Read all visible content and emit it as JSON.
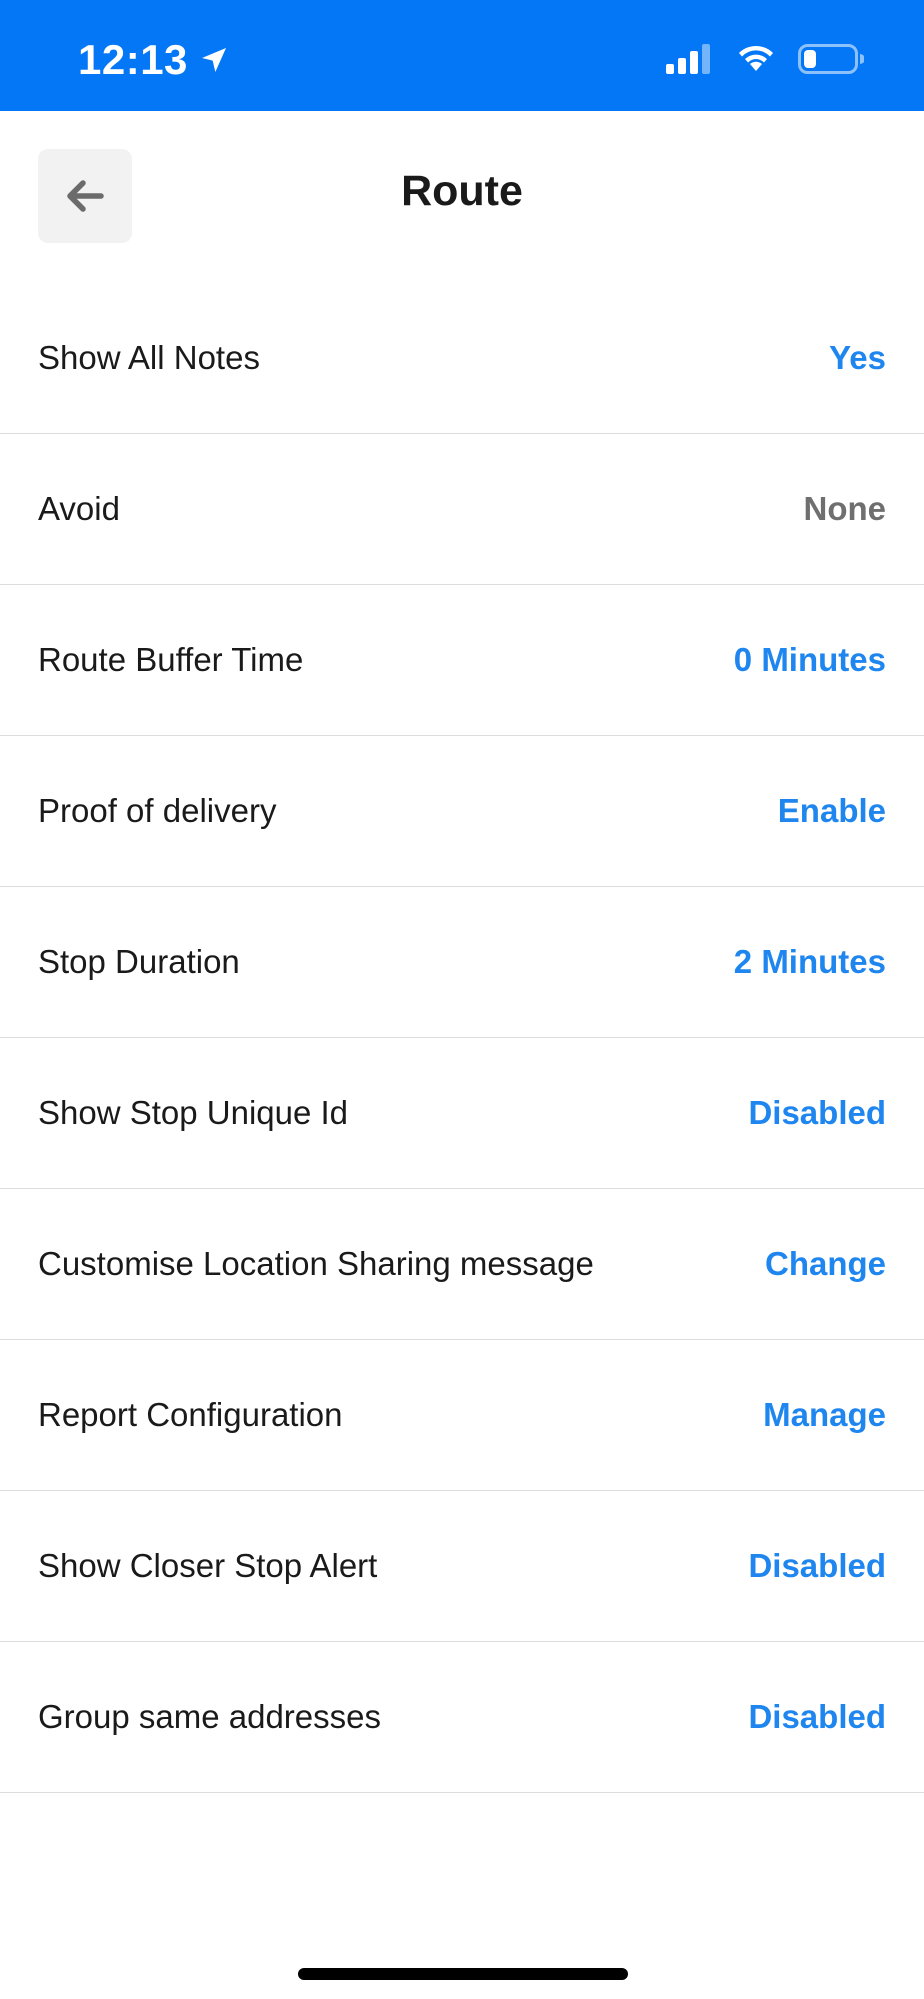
{
  "status_bar": {
    "time": "12:13",
    "background": "#0377f5"
  },
  "header": {
    "title": "Route",
    "back_icon": "arrow-left-icon"
  },
  "settings": [
    {
      "label": "Show All Notes",
      "value": "Yes",
      "muted": false
    },
    {
      "label": "Avoid",
      "value": "None",
      "muted": true
    },
    {
      "label": "Route Buffer Time",
      "value": "0 Minutes",
      "muted": false
    },
    {
      "label": "Proof of delivery",
      "value": "Enable",
      "muted": false
    },
    {
      "label": "Stop Duration",
      "value": "2 Minutes",
      "muted": false
    },
    {
      "label": "Show Stop Unique Id",
      "value": "Disabled",
      "muted": false
    },
    {
      "label": "Customise Location Sharing message",
      "value": "Change",
      "muted": false
    },
    {
      "label": "Report Configuration",
      "value": "Manage",
      "muted": false
    },
    {
      "label": "Show Closer Stop Alert",
      "value": "Disabled",
      "muted": false
    },
    {
      "label": "Group same addresses",
      "value": "Disabled",
      "muted": false
    }
  ],
  "colors": {
    "accent": "#1e86ee",
    "muted": "#6f6f6f",
    "divider": "#dcdcdc"
  }
}
